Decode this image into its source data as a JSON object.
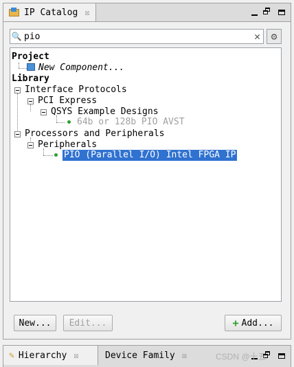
{
  "window": {
    "tab_title": "IP Catalog",
    "close_glyph": "☒"
  },
  "search": {
    "value": "pio",
    "placeholder": ""
  },
  "tree": {
    "project_header": "Project",
    "new_component": "New Component...",
    "library_header": "Library",
    "interface_protocols": "Interface Protocols",
    "pci_express": "PCI Express",
    "qsys_example_designs": "QSYS Example Designs",
    "pio_avst": "64b or 128b PIO AVST",
    "processors_and_peripherals": "Processors and Peripherals",
    "peripherals": "Peripherals",
    "pio_intel": "PIO (Parallel I/O) Intel FPGA IP"
  },
  "buttons": {
    "new": "New...",
    "edit": "Edit...",
    "add": "Add..."
  },
  "bottom_tabs": {
    "hierarchy": "Hierarchy",
    "device_family": "Device Family"
  },
  "watermark": "CSDN @十五",
  "colors": {
    "selection": "#3072d0",
    "ip_dot": "#2ca02c"
  }
}
